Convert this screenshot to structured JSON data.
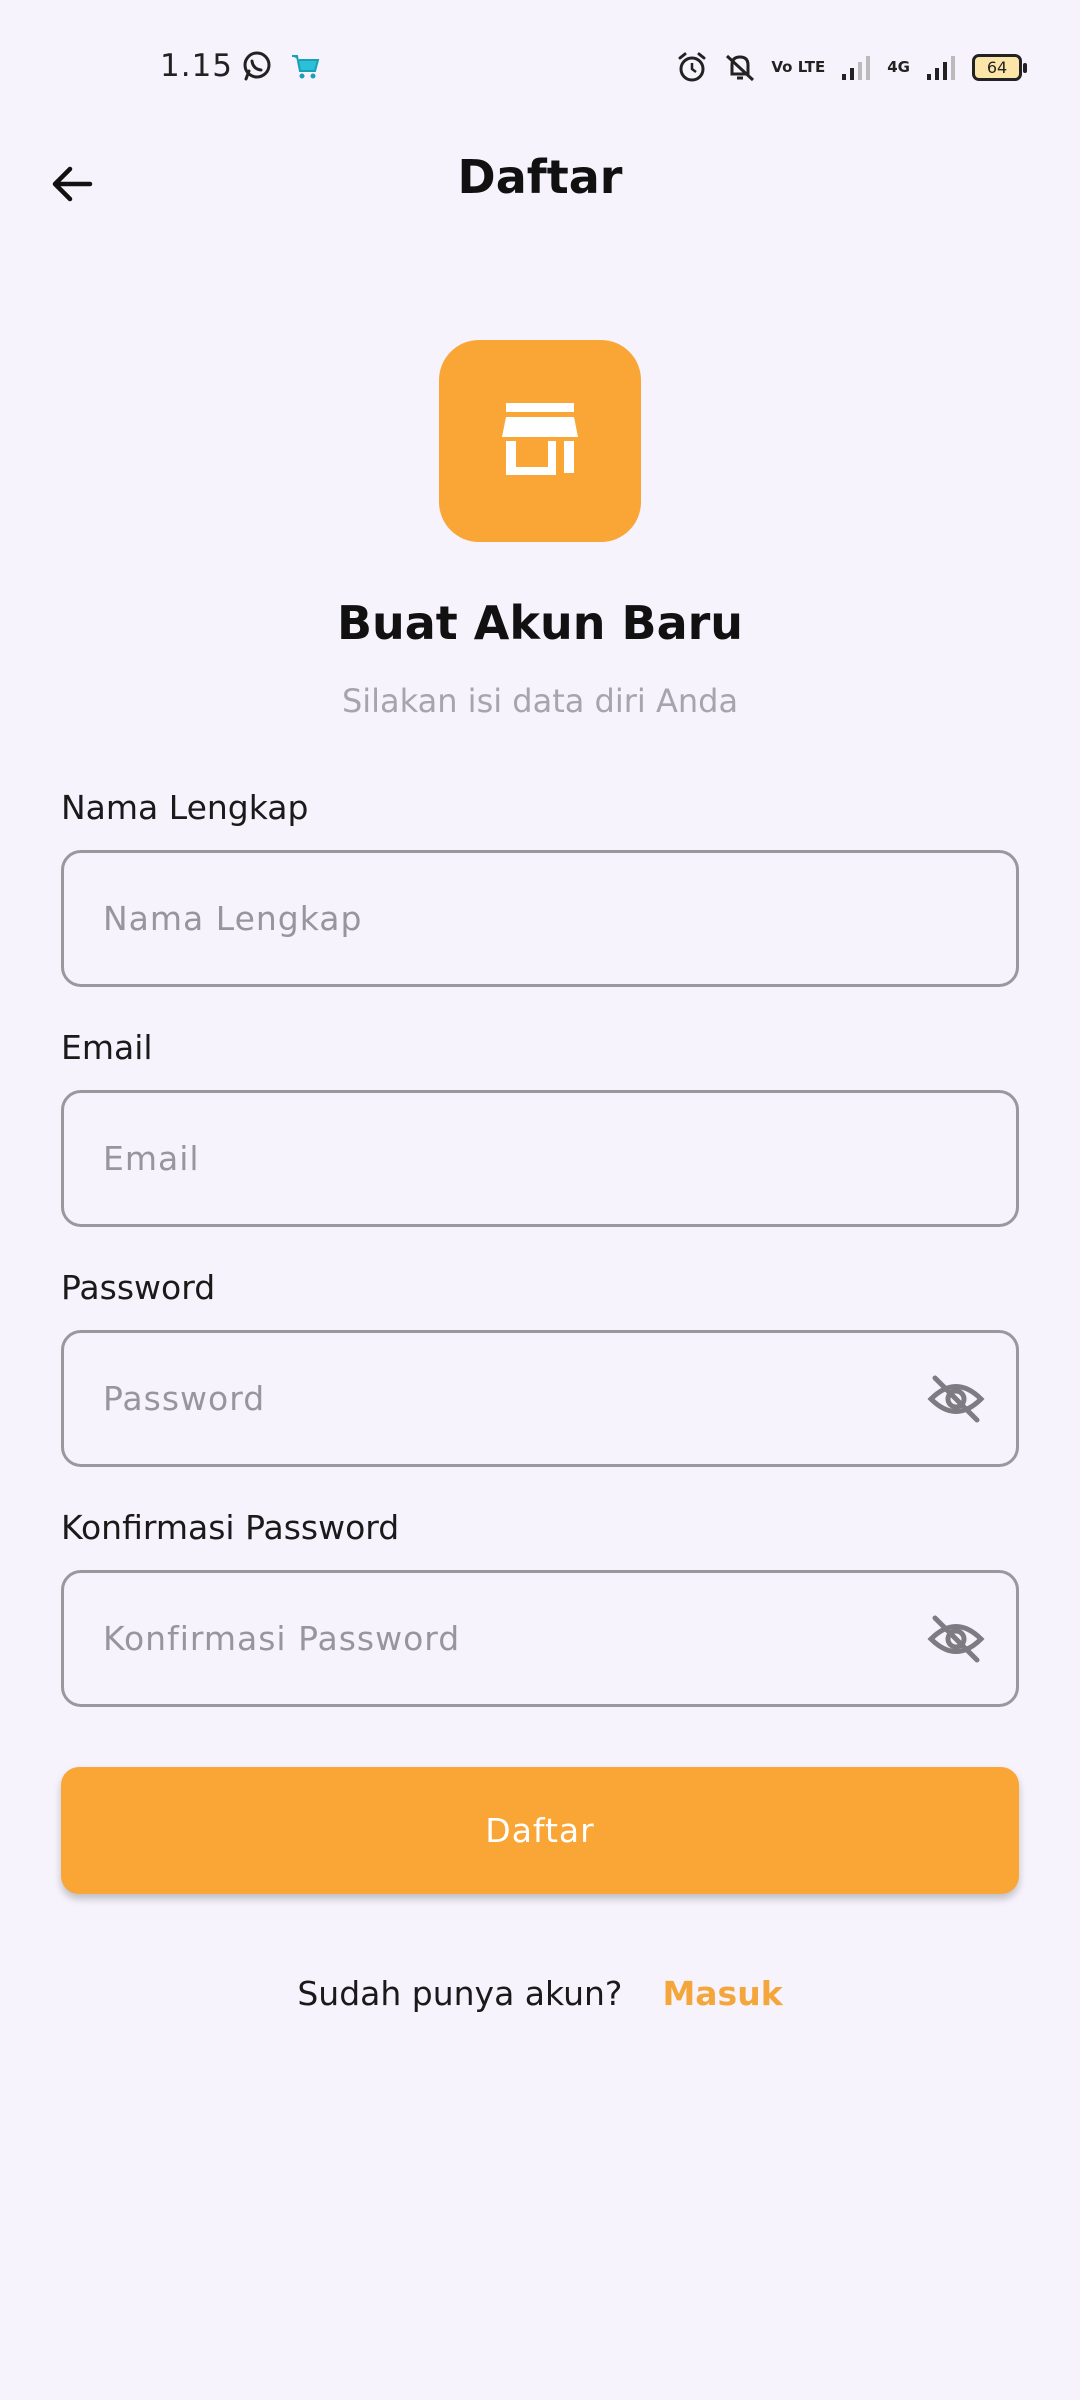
{
  "status_bar": {
    "time": "1.15",
    "left_icons": [
      "whatsapp-icon",
      "shopping-cart-app-icon"
    ],
    "right_icons": [
      "alarm-icon",
      "mute-icon",
      "volte-icon",
      "signal-icon",
      "4g-signal-icon",
      "battery-icon"
    ],
    "volte_text": "Vo LTE",
    "network_text": "4G",
    "battery_level": "64"
  },
  "app_bar": {
    "title": "Daftar",
    "back_icon": "arrow-left-icon"
  },
  "logo": {
    "icon": "store-icon",
    "color": "#faa636"
  },
  "heading": "Buat Akun Baru",
  "subheading": "Silakan isi data diri Anda",
  "form": {
    "full_name": {
      "label": "Nama Lengkap",
      "placeholder": "Nama Lengkap",
      "value": ""
    },
    "email": {
      "label": "Email",
      "placeholder": "Email",
      "value": ""
    },
    "password": {
      "label": "Password",
      "placeholder": "Password",
      "value": "",
      "toggle_icon": "eye-off-icon"
    },
    "confirm_password": {
      "label": "Konfirmasi Password",
      "placeholder": "Konfirmasi Password",
      "value": "",
      "toggle_icon": "eye-off-icon"
    }
  },
  "submit_label": "Daftar",
  "login_prompt": "Sudah punya akun?",
  "login_link": "Masuk",
  "colors": {
    "accent": "#faa636",
    "background": "#f6f3fc",
    "border": "#9a979d",
    "placeholder": "#98959c"
  }
}
